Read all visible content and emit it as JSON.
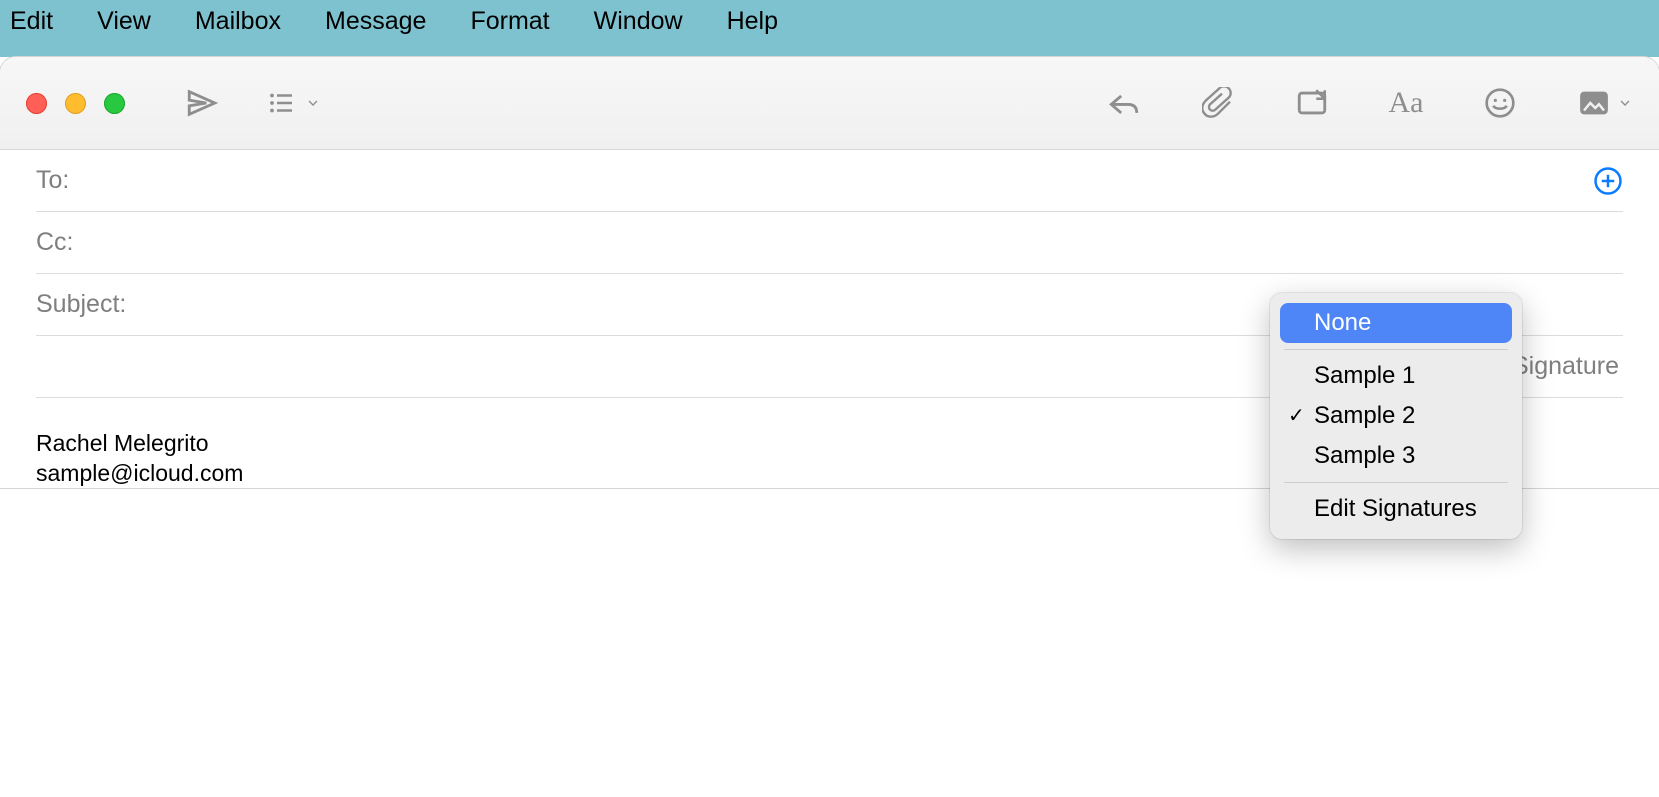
{
  "menubar": [
    "Edit",
    "View",
    "Mailbox",
    "Message",
    "Format",
    "Window",
    "Help"
  ],
  "toolbar": {
    "traffic": [
      "close",
      "minimize",
      "zoom"
    ]
  },
  "fields": {
    "to_label": "To:",
    "cc_label": "Cc:",
    "subject_label": "Subject:",
    "signature_label": "Signature"
  },
  "signature_body": {
    "name": "Rachel Melegrito",
    "email": "sample@icloud.com"
  },
  "signature_menu": {
    "none": "None",
    "items": [
      "Sample 1",
      "Sample 2",
      "Sample 3"
    ],
    "selected_index": 1,
    "edit": "Edit Signatures"
  }
}
